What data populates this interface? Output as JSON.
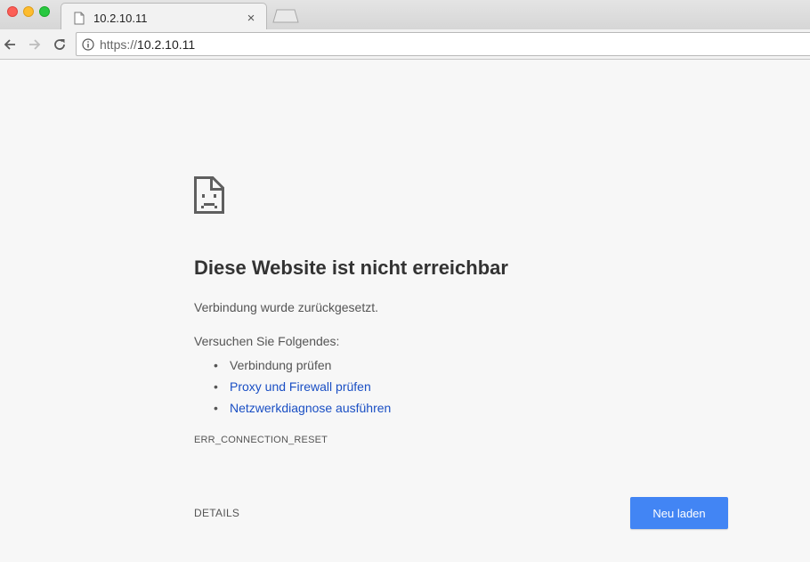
{
  "window": {
    "traffic_lights": [
      "close",
      "minimize",
      "maximize"
    ]
  },
  "tab": {
    "title": "10.2.10.11",
    "close_glyph": "×",
    "icon": "document-icon"
  },
  "toolbar": {
    "url_scheme": "https://",
    "url_host": "10.2.10.11"
  },
  "error": {
    "icon": "sad-page-icon",
    "heading": "Diese Website ist nicht erreichbar",
    "subtext": "Verbindung wurde zurückgesetzt.",
    "suggest_intro": "Versuchen Sie Folgendes:",
    "suggestions": [
      {
        "label": "Verbindung prüfen",
        "link": false
      },
      {
        "label": "Proxy und Firewall prüfen",
        "link": true
      },
      {
        "label": "Netzwerkdiagnose ausführen",
        "link": true
      }
    ],
    "code": "ERR_CONNECTION_RESET"
  },
  "actions": {
    "details_label": "DETAILS",
    "reload_label": "Neu laden"
  },
  "colors": {
    "accent": "#4285f4",
    "link": "#1a4fc4",
    "background": "#f7f7f7"
  }
}
